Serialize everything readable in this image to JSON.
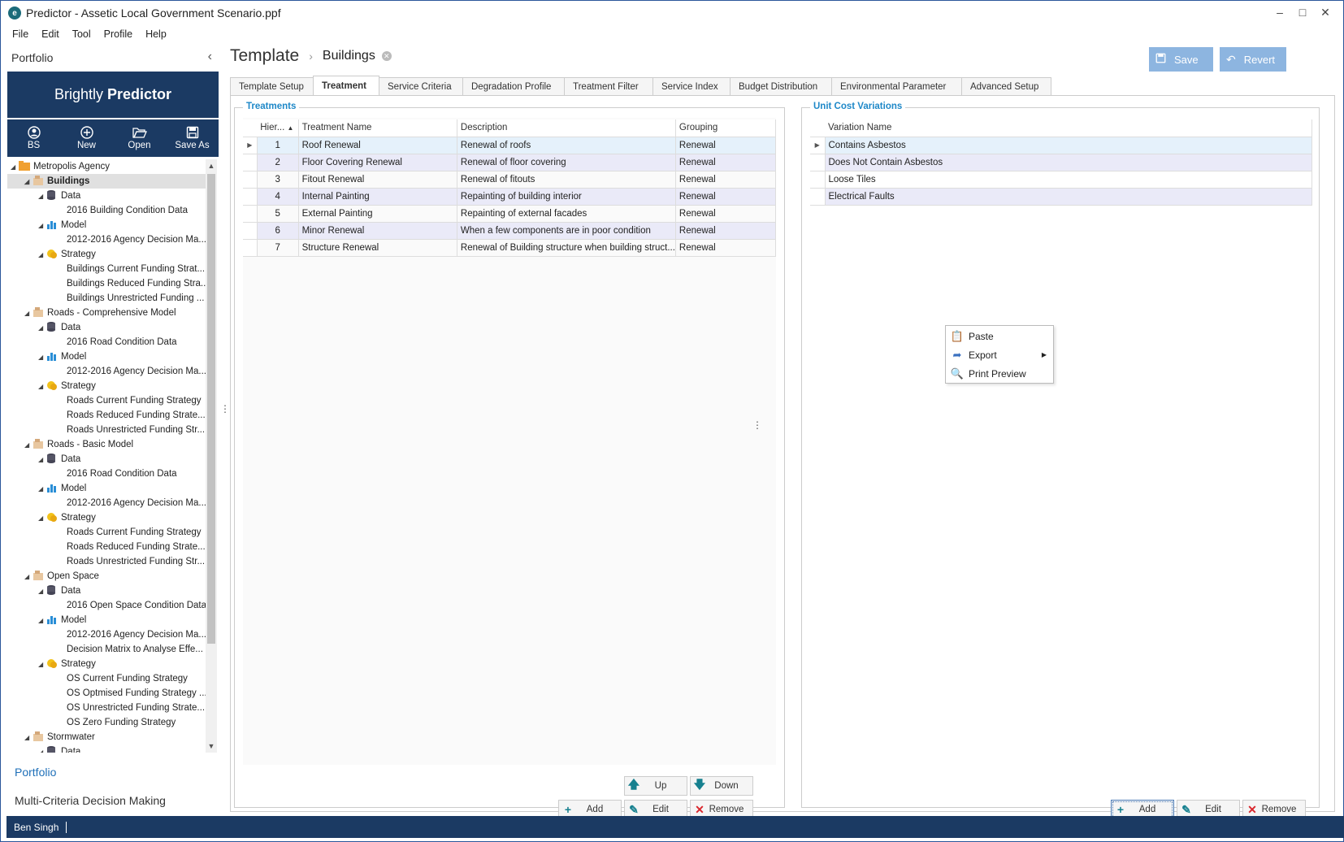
{
  "window": {
    "title": "Predictor - Assetic Local Government Scenario.ppf",
    "logo_letter": "e",
    "controls": {
      "minimize": "–",
      "maximize": "□",
      "close": "✕"
    }
  },
  "menu": [
    "File",
    "Edit",
    "Tool",
    "Profile",
    "Help"
  ],
  "left_panel": {
    "header": "Portfolio",
    "collapse_glyph": "‹",
    "brand_light": "Brightly",
    "brand_bold": "Predictor",
    "toolbar": [
      {
        "label": "BS",
        "icon": "user-icon"
      },
      {
        "label": "New",
        "icon": "plus-circle-icon"
      },
      {
        "label": "Open",
        "icon": "folder-open-icon"
      },
      {
        "label": "Save As",
        "icon": "save-icon"
      }
    ],
    "tree": [
      {
        "label": "Metropolis Agency",
        "level": 0,
        "type": "agency",
        "expanded": true
      },
      {
        "label": "Buildings",
        "level": 1,
        "type": "asset",
        "expanded": true,
        "selected": true
      },
      {
        "label": "Data",
        "level": 2,
        "type": "data",
        "expanded": true
      },
      {
        "label": "2016 Building Condition Data",
        "level": 3,
        "type": "leaf"
      },
      {
        "label": "Model",
        "level": 2,
        "type": "model",
        "expanded": true
      },
      {
        "label": "2012-2016 Agency Decision Ma...",
        "level": 3,
        "type": "leaf"
      },
      {
        "label": "Strategy",
        "level": 2,
        "type": "strategy",
        "expanded": true
      },
      {
        "label": "Buildings Current Funding Strat...",
        "level": 3,
        "type": "leaf"
      },
      {
        "label": "Buildings Reduced Funding Stra...",
        "level": 3,
        "type": "leaf"
      },
      {
        "label": "Buildings Unrestricted Funding ...",
        "level": 3,
        "type": "leaf"
      },
      {
        "label": "Roads - Comprehensive Model",
        "level": 1,
        "type": "asset",
        "expanded": true
      },
      {
        "label": "Data",
        "level": 2,
        "type": "data",
        "expanded": true
      },
      {
        "label": "2016 Road Condition Data",
        "level": 3,
        "type": "leaf"
      },
      {
        "label": "Model",
        "level": 2,
        "type": "model",
        "expanded": true
      },
      {
        "label": "2012-2016 Agency Decision Ma...",
        "level": 3,
        "type": "leaf"
      },
      {
        "label": "Strategy",
        "level": 2,
        "type": "strategy",
        "expanded": true
      },
      {
        "label": "Roads Current Funding Strategy",
        "level": 3,
        "type": "leaf"
      },
      {
        "label": "Roads Reduced Funding Strate...",
        "level": 3,
        "type": "leaf"
      },
      {
        "label": "Roads Unrestricted Funding Str...",
        "level": 3,
        "type": "leaf"
      },
      {
        "label": "Roads - Basic Model",
        "level": 1,
        "type": "asset",
        "expanded": true
      },
      {
        "label": "Data",
        "level": 2,
        "type": "data",
        "expanded": true
      },
      {
        "label": "2016 Road Condition Data",
        "level": 3,
        "type": "leaf"
      },
      {
        "label": "Model",
        "level": 2,
        "type": "model",
        "expanded": true
      },
      {
        "label": "2012-2016 Agency Decision Ma...",
        "level": 3,
        "type": "leaf"
      },
      {
        "label": "Strategy",
        "level": 2,
        "type": "strategy",
        "expanded": true
      },
      {
        "label": "Roads Current Funding Strategy",
        "level": 3,
        "type": "leaf"
      },
      {
        "label": "Roads Reduced Funding Strate...",
        "level": 3,
        "type": "leaf"
      },
      {
        "label": "Roads Unrestricted Funding Str...",
        "level": 3,
        "type": "leaf"
      },
      {
        "label": "Open Space",
        "level": 1,
        "type": "asset",
        "expanded": true
      },
      {
        "label": "Data",
        "level": 2,
        "type": "data",
        "expanded": true
      },
      {
        "label": "2016 Open Space Condition Data",
        "level": 3,
        "type": "leaf"
      },
      {
        "label": "Model",
        "level": 2,
        "type": "model",
        "expanded": true
      },
      {
        "label": "2012-2016 Agency Decision Ma...",
        "level": 3,
        "type": "leaf"
      },
      {
        "label": "Decision Matrix to Analyse Effe...",
        "level": 3,
        "type": "leaf"
      },
      {
        "label": "Strategy",
        "level": 2,
        "type": "strategy",
        "expanded": true
      },
      {
        "label": "OS Current Funding Strategy",
        "level": 3,
        "type": "leaf"
      },
      {
        "label": "OS Optmised Funding Strategy ...",
        "level": 3,
        "type": "leaf"
      },
      {
        "label": "OS Unrestricted Funding Strate...",
        "level": 3,
        "type": "leaf"
      },
      {
        "label": "OS Zero Funding Strategy",
        "level": 3,
        "type": "leaf"
      },
      {
        "label": "Stormwater",
        "level": 1,
        "type": "asset",
        "expanded": true
      },
      {
        "label": "Data",
        "level": 2,
        "type": "data",
        "expanded": true
      }
    ],
    "links": [
      "Portfolio",
      "Multi-Criteria Decision Making"
    ]
  },
  "status_bar": {
    "user": "Ben Singh"
  },
  "main": {
    "breadcrumb": {
      "root": "Template",
      "separator": "›",
      "current": "Buildings"
    },
    "buttons": {
      "save": "Save",
      "revert": "Revert"
    },
    "tabs": [
      "Template Setup",
      "Treatment",
      "Service Criteria",
      "Degradation Profile",
      "Treatment Filter",
      "Service Index",
      "Budget Distribution",
      "Environmental Parameter",
      "Advanced Setup"
    ],
    "active_tab": "Treatment",
    "treatments": {
      "title": "Treatments",
      "columns": [
        "Hier...",
        "Treatment Name",
        "Description",
        "Grouping"
      ],
      "rows": [
        [
          "1",
          "Roof Renewal",
          "Renewal of roofs",
          "Renewal"
        ],
        [
          "2",
          "Floor Covering Renewal",
          "Renewal of floor covering",
          "Renewal"
        ],
        [
          "3",
          "Fitout Renewal",
          "Renewal of fitouts",
          "Renewal"
        ],
        [
          "4",
          "Internal Painting",
          "Repainting of building interior",
          "Renewal"
        ],
        [
          "5",
          "External Painting",
          "Repainting of external facades",
          "Renewal"
        ],
        [
          "6",
          "Minor Renewal",
          "When a few components are in poor condition",
          "Renewal"
        ],
        [
          "7",
          "Structure  Renewal",
          "Renewal of Building structure when building struct...",
          "Renewal"
        ]
      ],
      "buttons": {
        "up": "Up",
        "down": "Down",
        "add": "Add",
        "edit": "Edit",
        "remove": "Remove"
      }
    },
    "variations": {
      "title": "Unit Cost Variations",
      "columns": [
        "Variation Name"
      ],
      "rows": [
        "Contains Asbestos",
        "Does Not Contain Asbestos",
        "Loose Tiles",
        "Electrical Faults"
      ],
      "buttons": {
        "add": "Add",
        "edit": "Edit",
        "remove": "Remove"
      }
    },
    "context_menu": [
      "Paste",
      "Export",
      "Print Preview"
    ]
  },
  "colors": {
    "navy": "#1b3a63",
    "accent_blue": "#1e88c8",
    "button_blue": "#8db5e0",
    "row_alt": "#eaeaf8",
    "remove_red": "#d9262c",
    "add_teal": "#16808f"
  }
}
